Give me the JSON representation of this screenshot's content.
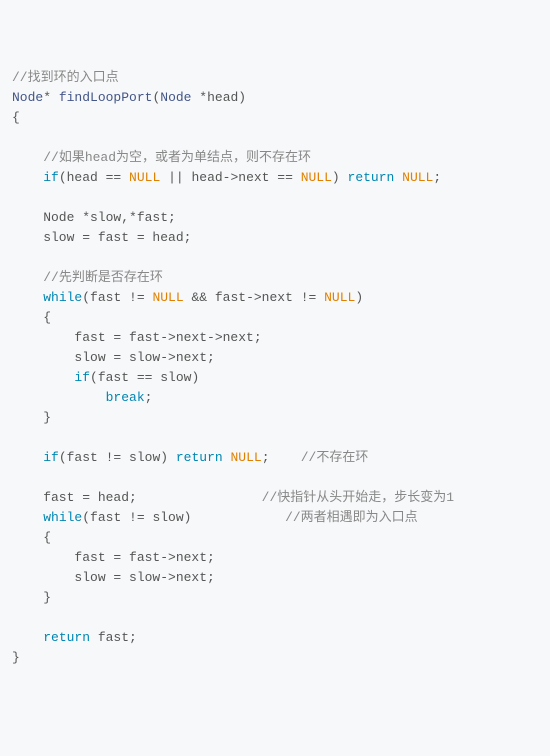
{
  "lines": [
    [
      {
        "cls": "comment",
        "t": "//找到环的入口点"
      }
    ],
    [
      {
        "cls": "type",
        "t": "Node"
      },
      {
        "cls": "plain",
        "t": "* "
      },
      {
        "cls": "type",
        "t": "findLoopPort"
      },
      {
        "cls": "plain",
        "t": "("
      },
      {
        "cls": "type",
        "t": "Node"
      },
      {
        "cls": "plain",
        "t": " *head)"
      }
    ],
    [
      {
        "cls": "plain",
        "t": "{"
      }
    ],
    [
      {
        "cls": "plain",
        "t": ""
      }
    ],
    [
      {
        "cls": "plain",
        "t": "    "
      },
      {
        "cls": "comment",
        "t": "//如果head为空，或者为单结点，则不存在环"
      }
    ],
    [
      {
        "cls": "plain",
        "t": "    "
      },
      {
        "cls": "keyword",
        "t": "if"
      },
      {
        "cls": "plain",
        "t": "(head == "
      },
      {
        "cls": "null",
        "t": "NULL"
      },
      {
        "cls": "plain",
        "t": " || head->next == "
      },
      {
        "cls": "null",
        "t": "NULL"
      },
      {
        "cls": "plain",
        "t": ") "
      },
      {
        "cls": "keyword",
        "t": "return"
      },
      {
        "cls": "plain",
        "t": " "
      },
      {
        "cls": "null",
        "t": "NULL"
      },
      {
        "cls": "plain",
        "t": ";"
      }
    ],
    [
      {
        "cls": "plain",
        "t": ""
      }
    ],
    [
      {
        "cls": "plain",
        "t": "    Node *slow,*fast;"
      }
    ],
    [
      {
        "cls": "plain",
        "t": "    slow = fast = head;"
      }
    ],
    [
      {
        "cls": "plain",
        "t": ""
      }
    ],
    [
      {
        "cls": "plain",
        "t": "    "
      },
      {
        "cls": "comment",
        "t": "//先判断是否存在环"
      }
    ],
    [
      {
        "cls": "plain",
        "t": "    "
      },
      {
        "cls": "keyword",
        "t": "while"
      },
      {
        "cls": "plain",
        "t": "(fast != "
      },
      {
        "cls": "null",
        "t": "NULL"
      },
      {
        "cls": "plain",
        "t": " && fast->next != "
      },
      {
        "cls": "null",
        "t": "NULL"
      },
      {
        "cls": "plain",
        "t": ")"
      }
    ],
    [
      {
        "cls": "plain",
        "t": "    {"
      }
    ],
    [
      {
        "cls": "plain",
        "t": "        fast = fast->next->next;"
      }
    ],
    [
      {
        "cls": "plain",
        "t": "        slow = slow->next;"
      }
    ],
    [
      {
        "cls": "plain",
        "t": "        "
      },
      {
        "cls": "keyword",
        "t": "if"
      },
      {
        "cls": "plain",
        "t": "(fast == slow)"
      }
    ],
    [
      {
        "cls": "plain",
        "t": "            "
      },
      {
        "cls": "keyword",
        "t": "break"
      },
      {
        "cls": "plain",
        "t": ";"
      }
    ],
    [
      {
        "cls": "plain",
        "t": "    }"
      }
    ],
    [
      {
        "cls": "plain",
        "t": ""
      }
    ],
    [
      {
        "cls": "plain",
        "t": "    "
      },
      {
        "cls": "keyword",
        "t": "if"
      },
      {
        "cls": "plain",
        "t": "(fast != slow) "
      },
      {
        "cls": "keyword",
        "t": "return"
      },
      {
        "cls": "plain",
        "t": " "
      },
      {
        "cls": "null",
        "t": "NULL"
      },
      {
        "cls": "plain",
        "t": ";    "
      },
      {
        "cls": "comment",
        "t": "//不存在环"
      }
    ],
    [
      {
        "cls": "plain",
        "t": ""
      }
    ],
    [
      {
        "cls": "plain",
        "t": "    fast = head;                "
      },
      {
        "cls": "comment",
        "t": "//快指针从头开始走，步长变为1"
      }
    ],
    [
      {
        "cls": "plain",
        "t": "    "
      },
      {
        "cls": "keyword",
        "t": "while"
      },
      {
        "cls": "plain",
        "t": "(fast != slow)            "
      },
      {
        "cls": "comment",
        "t": "//两者相遇即为入口点"
      }
    ],
    [
      {
        "cls": "plain",
        "t": "    {"
      }
    ],
    [
      {
        "cls": "plain",
        "t": "        fast = fast->next;"
      }
    ],
    [
      {
        "cls": "plain",
        "t": "        slow = slow->next;"
      }
    ],
    [
      {
        "cls": "plain",
        "t": "    }"
      }
    ],
    [
      {
        "cls": "plain",
        "t": ""
      }
    ],
    [
      {
        "cls": "plain",
        "t": "    "
      },
      {
        "cls": "keyword",
        "t": "return"
      },
      {
        "cls": "plain",
        "t": " fast;"
      }
    ],
    [
      {
        "cls": "plain",
        "t": "}"
      }
    ]
  ]
}
